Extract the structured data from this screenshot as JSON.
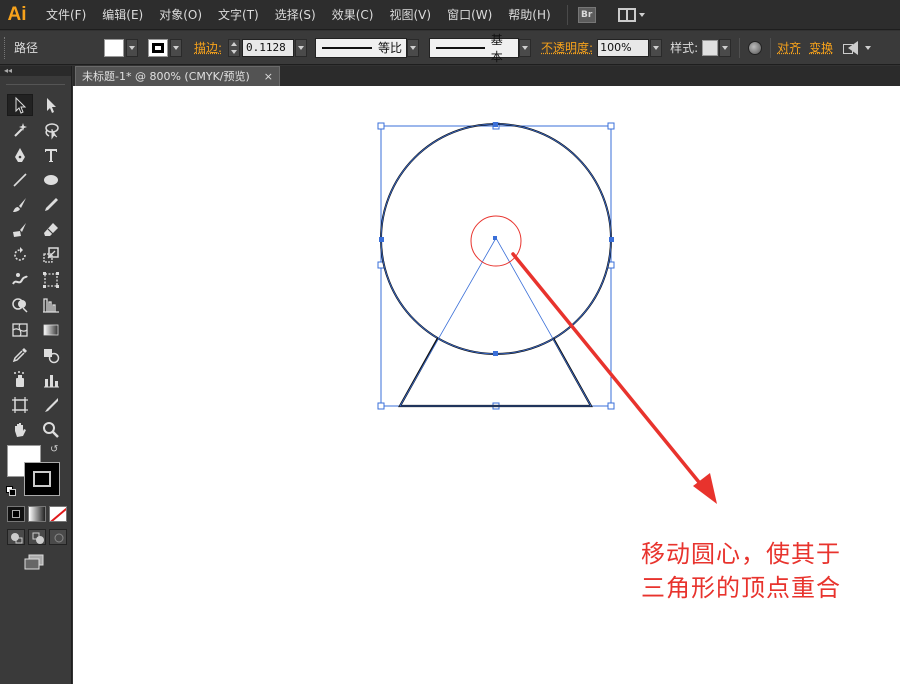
{
  "app": {
    "logo": "Ai",
    "menu": [
      "文件(F)",
      "编辑(E)",
      "对象(O)",
      "文字(T)",
      "选择(S)",
      "效果(C)",
      "视图(V)",
      "窗口(W)",
      "帮助(H)"
    ],
    "bridge_label": "Br"
  },
  "control_bar": {
    "selection_type": "路径",
    "fill_color": "#ffffff",
    "stroke_label": "描边:",
    "stroke_weight": "0.1128",
    "variable_width_profile": "等比",
    "brush_definition": "基本",
    "opacity_label": "不透明度:",
    "opacity_value": "100%",
    "style_label": "样式:",
    "align_label": "对齐",
    "transform_label": "变换"
  },
  "document": {
    "tab_title": "未标题-1* @ 800% (CMYK/预览)",
    "close_glyph": "×"
  },
  "toolbox": {
    "collapse_glyph": "◂◂",
    "tools_left": [
      "selection-tool",
      "magic-wand-tool",
      "pen-tool",
      "line-segment-tool",
      "paintbrush-tool",
      "blob-brush-tool",
      "rotate-tool",
      "warp-tool",
      "shape-builder-tool",
      "mesh-tool",
      "eyedropper-tool",
      "symbol-sprayer-tool",
      "artboard-tool",
      "hand-tool"
    ],
    "tools_right": [
      "direct-selection-tool",
      "lasso-tool",
      "type-tool",
      "ellipse-tool",
      "pencil-tool",
      "eraser-tool",
      "scale-tool",
      "free-transform-tool",
      "perspective-grid-tool",
      "gradient-tool",
      "blend-tool",
      "column-graph-tool",
      "slice-tool",
      "zoom-tool"
    ],
    "fill_color": "#ffffff",
    "stroke_color": "#000000",
    "active_tool": "selection-tool"
  },
  "annotation": {
    "line1": "移动圆心，使其于",
    "line2": "三角形的顶点重合",
    "color": "#e8332d"
  },
  "colors": {
    "selection_blue": "#3a6fd8",
    "accent_orange": "#f7a21b",
    "arrow_red": "#e8332d"
  }
}
